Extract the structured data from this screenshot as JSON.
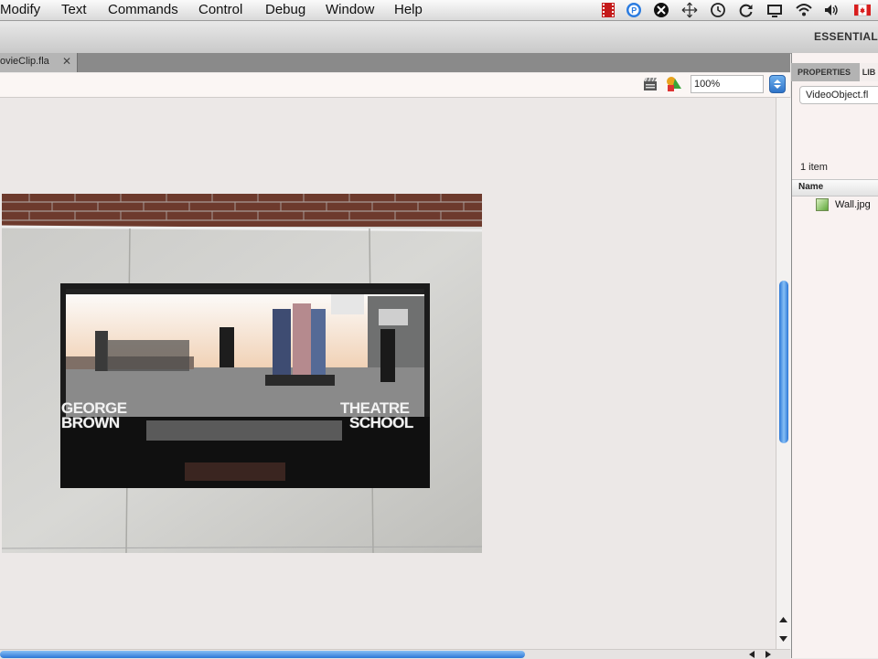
{
  "menubar": {
    "items": [
      "Modify",
      "Text",
      "Commands",
      "Control",
      "Debug",
      "Window",
      "Help"
    ],
    "status_icons": [
      "film-icon",
      "p-circle-icon",
      "bluetooth-icon",
      "move-icon",
      "time-machine-icon",
      "sync-icon",
      "display-icon",
      "wifi-icon",
      "volume-icon",
      "canada-flag-icon"
    ]
  },
  "workspace": {
    "label": "ESSENTIAL"
  },
  "document": {
    "tab_label": "ovieClip.fla",
    "close_glyph": "✕"
  },
  "editbar": {
    "zoom": "100%",
    "icons": [
      "edit-scene-icon",
      "edit-symbols-icon"
    ]
  },
  "stage": {
    "image": "Wall.jpg",
    "poster_left": [
      "GEORGE",
      "BROWN"
    ],
    "poster_right": [
      "THEATRE",
      "SCHOOL"
    ]
  },
  "panel": {
    "tabs": [
      "PROPERTIES",
      "LIB"
    ],
    "library_file": "VideoObject.fl",
    "item_count": "1 item",
    "name_header": "Name",
    "items": [
      {
        "name": "Wall.jpg",
        "icon": "bitmap-icon"
      }
    ]
  },
  "colors": {
    "accent": "#2c77d6",
    "stage": "#ece8e7"
  }
}
